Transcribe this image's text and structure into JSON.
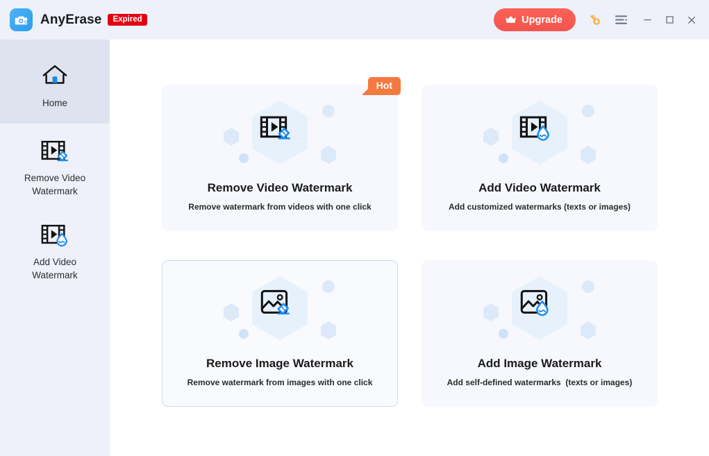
{
  "window": {
    "app_name": "AnyErase",
    "license_badge": "Expired",
    "logo_icon": "camera-eraser-icon",
    "upgrade_label": "Upgrade",
    "upgrade_icon": "crown-icon",
    "key_icon": "key-icon",
    "menu_icon": "hamburger-menu-icon",
    "minimize_icon": "minimize-icon",
    "maximize_icon": "maximize-icon",
    "close_icon": "close-icon"
  },
  "colors": {
    "chrome_bg": "#eef1fa",
    "sidebar_bg": "#eef1fa",
    "sidebar_active_bg": "#dde3ef",
    "content_bg": "#ffffff",
    "card_bg": "#f6f8fd",
    "accent_blue": "#1a8cf0",
    "upgrade_red": "#f4534b",
    "expired_red": "#e60012",
    "hot_orange": "#f4793f",
    "hex_fill": "#e4effb"
  },
  "sidebar": {
    "items": [
      {
        "label": "Home",
        "icon": "home-icon",
        "active": true
      },
      {
        "label": "Remove Video\nWatermark",
        "icon": "film-eraser-icon",
        "active": false
      },
      {
        "label": "Add Video\nWatermark",
        "icon": "film-droplet-icon",
        "active": false
      }
    ]
  },
  "main": {
    "cards": [
      {
        "title": "Remove Video Watermark",
        "subtitle": "Remove watermark from videos with one click",
        "icon": "film-eraser-icon",
        "badge": "Hot",
        "hovered": false
      },
      {
        "title": "Add Video Watermark",
        "subtitle": "Add customized watermarks (texts or images)",
        "icon": "film-droplet-icon",
        "badge": null,
        "hovered": false
      },
      {
        "title": "Remove Image Watermark",
        "subtitle": "Remove watermark from images with one click",
        "icon": "image-eraser-icon",
        "badge": null,
        "hovered": true
      },
      {
        "title": "Add Image Watermark",
        "subtitle": "Add self-defined watermarks  (texts or images)",
        "icon": "image-droplet-icon",
        "badge": null,
        "hovered": false
      }
    ]
  }
}
